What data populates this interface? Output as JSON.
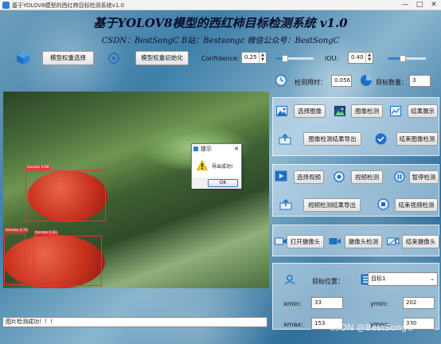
{
  "window": {
    "title": "基于YOLOV8模型的西红柿目标检测系统v1.0",
    "minimize": "—",
    "maximize": "□",
    "close": "✕"
  },
  "header": {
    "title": "基于YOLOV8模型的西红柿目标检测系统 v1.0",
    "subtitle": "CSDN：BestSongC   B站：Bestsongc   微信公众号：BestSongC"
  },
  "toolbar": {
    "model_select": "模型权重选择",
    "model_init": "模型权重初始化",
    "confidence_label": "Confidence:",
    "confidence_value": "0.25",
    "confidence_slider": 0.25,
    "iou_label": "IOU:",
    "iou_value": "0.40",
    "iou_slider": 0.4
  },
  "stats": {
    "time_label": "检测用时：",
    "time_value": "0.056",
    "count_label": "目标数量：",
    "count_value": "3"
  },
  "image_panel": {
    "detections": [
      {
        "label": "tomato  0.88"
      },
      {
        "label": "tomato  0.74"
      },
      {
        "label": "tomato  0.61"
      }
    ]
  },
  "dialog": {
    "title": "提示",
    "close": "✕",
    "message": "导出成功!",
    "ok": "OK"
  },
  "image_actions": {
    "select_image": "选择图像",
    "detect_image": "图像检测",
    "show_results": "结果展示",
    "export_image": "图像检测结果导出",
    "end_image": "结束图像检测"
  },
  "video_actions": {
    "select_video": "选择视频",
    "detect_video": "视频检测",
    "pause": "暂停检测",
    "export_video": "视频检测结果导出",
    "end_video": "结束视频检测"
  },
  "camera_actions": {
    "open_camera": "打开摄像头",
    "detect_camera": "摄像头检测",
    "close_camera": "结束摄像头"
  },
  "target": {
    "position_label": "目标位置：",
    "selected": "目标1",
    "xmin_label": "xmin:",
    "xmin": "33",
    "ymin_label": "ymin:",
    "ymin": "202",
    "xmax_label": "xmax:",
    "xmax": "153",
    "ymax_label": "ymax:",
    "ymax": "330"
  },
  "status": {
    "text": "图片检测成功！！！"
  },
  "watermark": "CSDN @BestSongC",
  "colors": {
    "accent": "#2b83d6",
    "bbox": "#e33333"
  }
}
